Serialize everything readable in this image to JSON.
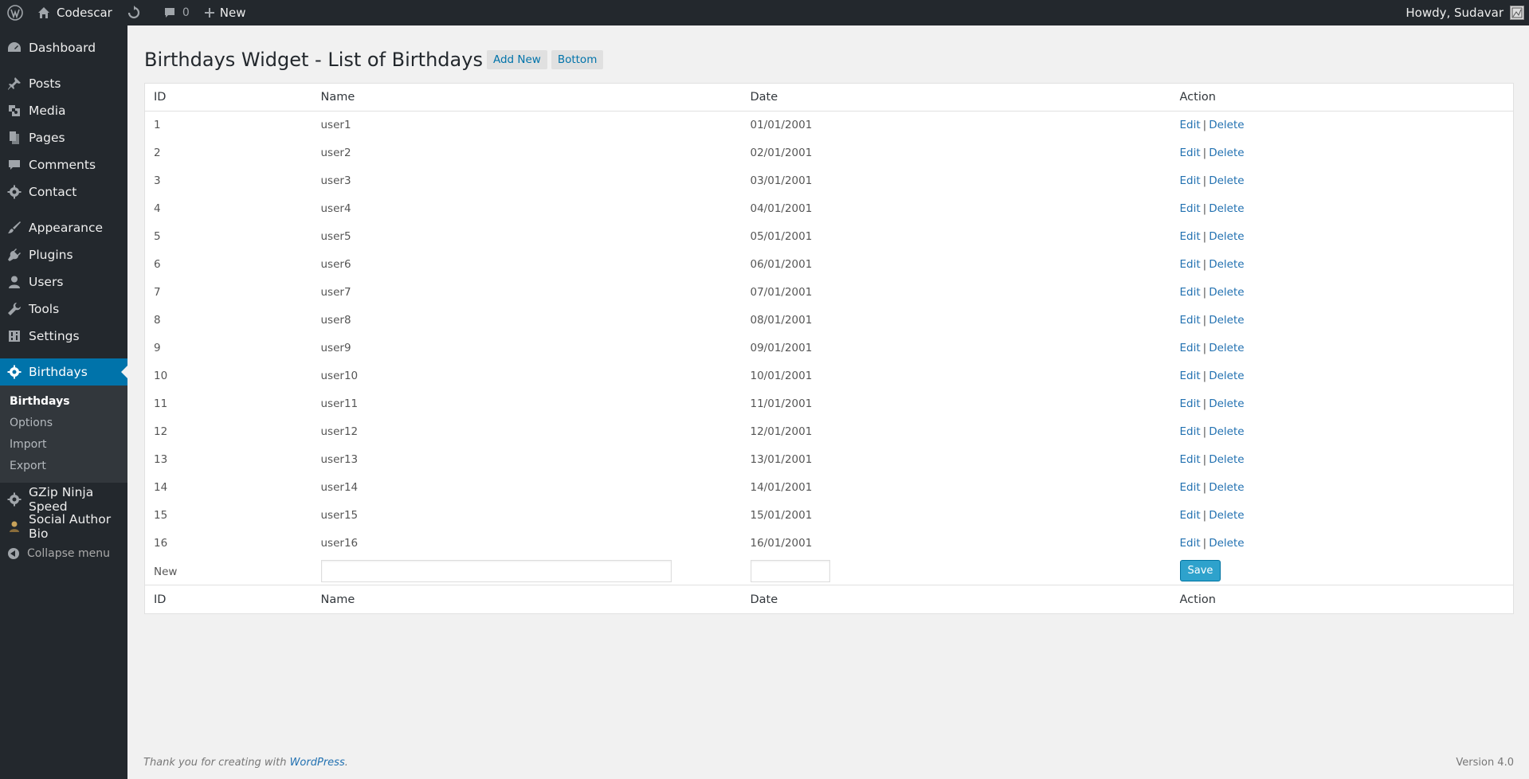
{
  "admin_bar": {
    "site_name": "Codescar",
    "comments_count": "0",
    "new_label": "New",
    "greeting": "Howdy, Sudavar"
  },
  "sidebar": {
    "items_top": [
      {
        "label": "Dashboard",
        "icon": "dashboard-icon"
      }
    ],
    "items_content": [
      {
        "label": "Posts",
        "icon": "pin-icon"
      },
      {
        "label": "Media",
        "icon": "media-icon"
      },
      {
        "label": "Pages",
        "icon": "pages-icon"
      },
      {
        "label": "Comments",
        "icon": "comment-icon"
      },
      {
        "label": "Contact",
        "icon": "gear-icon"
      }
    ],
    "items_admin": [
      {
        "label": "Appearance",
        "icon": "brush-icon"
      },
      {
        "label": "Plugins",
        "icon": "plugin-icon"
      },
      {
        "label": "Users",
        "icon": "user-icon"
      },
      {
        "label": "Tools",
        "icon": "wrench-icon"
      },
      {
        "label": "Settings",
        "icon": "settings-icon"
      }
    ],
    "active": {
      "label": "Birthdays",
      "icon": "gear-icon"
    },
    "submenu": [
      {
        "label": "Birthdays",
        "current": true
      },
      {
        "label": "Options"
      },
      {
        "label": "Import"
      },
      {
        "label": "Export"
      }
    ],
    "items_after": [
      {
        "label": "GZip Ninja Speed",
        "icon": "gear-icon"
      },
      {
        "label": "Social Author Bio",
        "icon": "author-icon"
      }
    ],
    "collapse_label": "Collapse menu"
  },
  "page": {
    "title": "Birthdays Widget - List of Birthdays",
    "add_new_label": "Add New",
    "bottom_label": "Bottom"
  },
  "table": {
    "headers": {
      "id": "ID",
      "name": "Name",
      "date": "Date",
      "action": "Action"
    },
    "rows": [
      {
        "id": "1",
        "name": "user1",
        "date": "01/01/2001"
      },
      {
        "id": "2",
        "name": "user2",
        "date": "02/01/2001"
      },
      {
        "id": "3",
        "name": "user3",
        "date": "03/01/2001"
      },
      {
        "id": "4",
        "name": "user4",
        "date": "04/01/2001"
      },
      {
        "id": "5",
        "name": "user5",
        "date": "05/01/2001"
      },
      {
        "id": "6",
        "name": "user6",
        "date": "06/01/2001"
      },
      {
        "id": "7",
        "name": "user7",
        "date": "07/01/2001"
      },
      {
        "id": "8",
        "name": "user8",
        "date": "08/01/2001"
      },
      {
        "id": "9",
        "name": "user9",
        "date": "09/01/2001"
      },
      {
        "id": "10",
        "name": "user10",
        "date": "10/01/2001"
      },
      {
        "id": "11",
        "name": "user11",
        "date": "11/01/2001"
      },
      {
        "id": "12",
        "name": "user12",
        "date": "12/01/2001"
      },
      {
        "id": "13",
        "name": "user13",
        "date": "13/01/2001"
      },
      {
        "id": "14",
        "name": "user14",
        "date": "14/01/2001"
      },
      {
        "id": "15",
        "name": "user15",
        "date": "15/01/2001"
      },
      {
        "id": "16",
        "name": "user16",
        "date": "16/01/2001"
      }
    ],
    "edit_label": "Edit",
    "delete_label": "Delete",
    "separator": "|",
    "new_row_label": "New",
    "name_value": "",
    "date_value": "",
    "save_label": "Save"
  },
  "footer": {
    "thanks_prefix": "Thank you for creating with ",
    "thanks_link": "WordPress",
    "thanks_suffix": ".",
    "version": "Version 4.0"
  }
}
